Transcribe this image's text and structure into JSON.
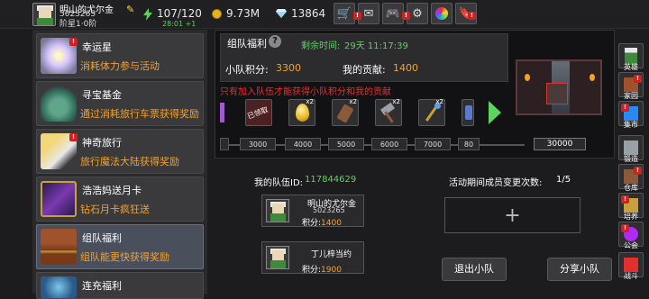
{
  "player": {
    "name": "明山的尤尔金",
    "id": "5023265",
    "vip": "阶星1·0阶"
  },
  "resources": {
    "energy": "107/120",
    "energy_regen": "28:01 +1",
    "gold": "9.73M",
    "gems": "13864"
  },
  "top_buttons": [
    "cart-icon",
    "mail-icon",
    "gamepad-icon",
    "gear-icon",
    "color-wheel-icon",
    "bookmark-icon"
  ],
  "left_list": [
    {
      "title": "幸运星",
      "subtitle": "消耗体力参与活动"
    },
    {
      "title": "寻宝基金",
      "subtitle": "通过消耗旅行车票获得奖励"
    },
    {
      "title": "神奇旅行",
      "subtitle": "旅行魔法大陆获得奖励"
    },
    {
      "title": "浩浩妈送月卡",
      "subtitle": "钻石月卡疯狂送"
    },
    {
      "title": "组队福利",
      "subtitle": "组队能更快获得奖励"
    },
    {
      "title": "连充福利",
      "subtitle": ""
    }
  ],
  "panel": {
    "title": "组队福利",
    "help": "?",
    "countdown_label": "剩余时间:",
    "countdown_value": "29天 11:17:39",
    "team_score_label": "小队积分:",
    "team_score_value": "3300",
    "my_contrib_label": "我的贡献:",
    "my_contrib_value": "1400",
    "warning": "只有加入队伍才能获得小队积分和我的贡献",
    "claimed_label": "已领取"
  },
  "rewards": [
    {
      "icon": "claimed-item-icon",
      "count": ""
    },
    {
      "icon": "golden-egg-icon",
      "count": "x2"
    },
    {
      "icon": "bottle-icon",
      "count": "x2"
    },
    {
      "icon": "hammer-icon",
      "count": "x2"
    },
    {
      "icon": "staff-icon",
      "count": "x2"
    },
    {
      "icon": "scroll-icon",
      "count": ""
    }
  ],
  "milestones": [
    "3000",
    "4000",
    "5000",
    "6000",
    "7000",
    "80"
  ],
  "final_milestone": "30000",
  "team": {
    "id_label": "我的队伍ID:",
    "id_value": "117844629",
    "changes_label": "活动期间成员变更次数:",
    "changes_value": "1/5",
    "members": [
      {
        "name": "明山的尤尔金",
        "id": "5023265",
        "score_label": "积分:",
        "score": "1400"
      },
      {
        "name": "丁儿梓当约",
        "id": "",
        "score_label": "积分:",
        "score": "1900"
      }
    ],
    "add_symbol": "+",
    "leave_label": "退出小队",
    "share_label": "分享小队"
  },
  "right_menu": [
    {
      "label": "英雄",
      "icon": "hero-icon"
    },
    {
      "label": "家园",
      "icon": "home-icon"
    },
    {
      "label": "集市",
      "icon": "market-icon"
    },
    {
      "label": "锻造",
      "icon": "forge-icon"
    },
    {
      "label": "仓库",
      "icon": "warehouse-icon"
    },
    {
      "label": "培养",
      "icon": "training-icon"
    },
    {
      "label": "公会",
      "icon": "guild-icon"
    },
    {
      "label": "战斗",
      "icon": "battle-icon"
    }
  ],
  "colors": {
    "accent_orange": "#f4a12a",
    "accent_green": "#5fd35f",
    "warning_red": "#e23030"
  }
}
